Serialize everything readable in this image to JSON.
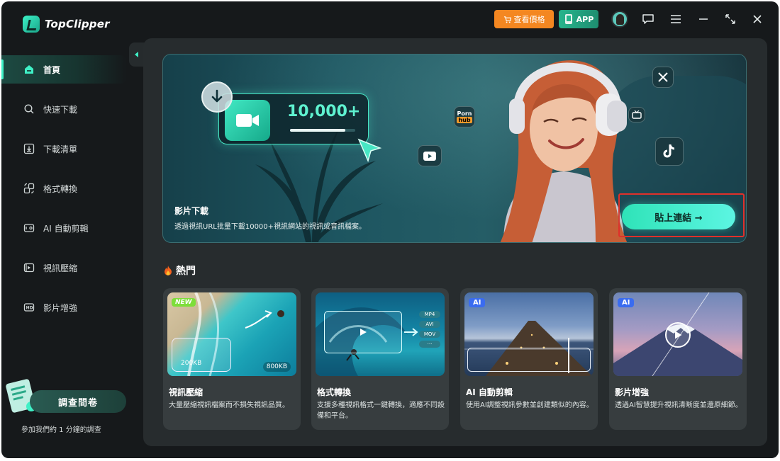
{
  "app": {
    "name": "TopClipper"
  },
  "titlebar": {
    "price_label": "查看價格",
    "app_label": "APP",
    "icons": [
      "cart-icon",
      "phone-app-icon",
      "avatar",
      "feedback-icon",
      "menu-icon",
      "minimize-icon",
      "expand-icon",
      "close-icon"
    ]
  },
  "sidebar": {
    "items": [
      {
        "label": "首頁",
        "icon": "home-icon",
        "active": true
      },
      {
        "label": "快速下載",
        "icon": "search-icon",
        "active": false
      },
      {
        "label": "下載清單",
        "icon": "download-list-icon",
        "active": false
      },
      {
        "label": "格式轉換",
        "icon": "convert-icon",
        "active": false
      },
      {
        "label": "AI 自動剪輯",
        "icon": "ai-edit-icon",
        "active": false
      },
      {
        "label": "視訊壓縮",
        "icon": "compress-icon",
        "active": false
      },
      {
        "label": "影片增強",
        "icon": "enhance-icon",
        "active": false
      }
    ],
    "survey": {
      "button_label": "調查問卷",
      "subtitle": "參加我們約 1 分鐘的調查"
    }
  },
  "banner": {
    "counter": "10,000+",
    "progress": 0.85,
    "title": "影片下載",
    "description": "透過視訊URL批量下載10000+視訊網站的視訊或音訊檔案。",
    "paste_button": "貼上連結 →",
    "platform_icons": [
      "porn-hub-icon",
      "youtube-icon",
      "x-icon",
      "tv-icon",
      "tiktok-icon"
    ],
    "porn_hub": {
      "top": "Porn",
      "bottom": "hub"
    }
  },
  "hot": {
    "title": "熱門",
    "cards": [
      {
        "title": "視訊壓縮",
        "desc": "大量壓縮視訊檔案而不損失視訊品質。",
        "tag": "NEW",
        "size_before": "200KB",
        "size_after": "800KB"
      },
      {
        "title": "格式轉換",
        "desc": "支援多種視訊格式一鍵轉換，適應不同設備和平台。",
        "tag": "",
        "formats": [
          "MP4",
          "AVI",
          "MOV",
          "···"
        ]
      },
      {
        "title": "AI 自動剪輯",
        "desc": "使用AI調整視訊參數並創建類似的內容。",
        "tag": "AI"
      },
      {
        "title": "影片增強",
        "desc": "透過AI智慧提升視訊清晰度並還原細節。",
        "tag": "AI"
      }
    ]
  },
  "colors": {
    "accent": "#3ff0c6",
    "price": "#f48721",
    "highlight": "#e0302a",
    "ai_tag": "#3a6cf0",
    "new_tag": "#7dde3a"
  }
}
